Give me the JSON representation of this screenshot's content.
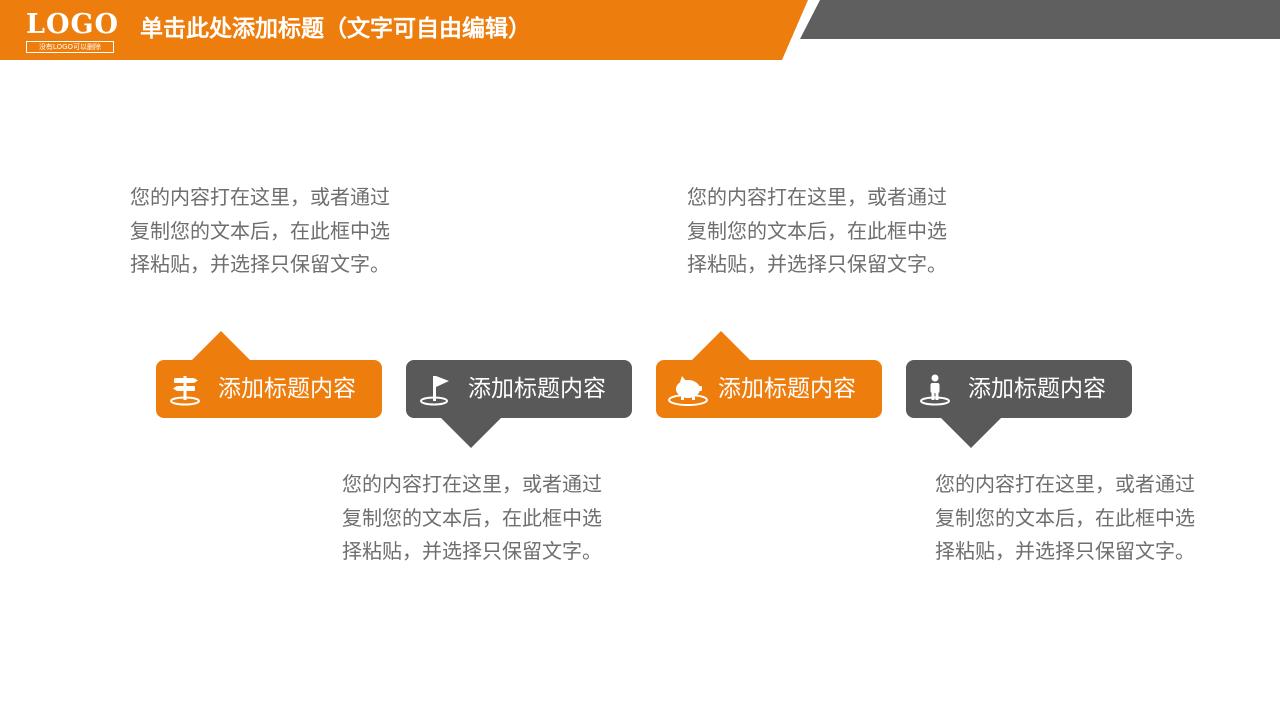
{
  "colors": {
    "orange": "#ED7D0D",
    "gray": "#595959",
    "header_gray": "#5F5F5F",
    "text": "#6E6E6E"
  },
  "header": {
    "logo": "LOGO",
    "logo_sub": "没有LOGO可以删除",
    "title": "单击此处添加标题（文字可自由编辑）"
  },
  "items": [
    {
      "label": "添加标题内容",
      "icon": "signpost-icon",
      "color": "orange",
      "text_position": "above",
      "body": "您的内容打在这里，或者通过复制您的文本后，在此框中选择粘贴，并选择只保留文字。"
    },
    {
      "label": "添加标题内容",
      "icon": "flag-icon",
      "color": "gray",
      "text_position": "below",
      "body": "您的内容打在这里，或者通过复制您的文本后，在此框中选择粘贴，并选择只保留文字。"
    },
    {
      "label": "添加标题内容",
      "icon": "piggy-bank-icon",
      "color": "orange",
      "text_position": "above",
      "body": "您的内容打在这里，或者通过复制您的文本后，在此框中选择粘贴，并选择只保留文字。"
    },
    {
      "label": "添加标题内容",
      "icon": "person-pin-icon",
      "color": "gray",
      "text_position": "below",
      "body": "您的内容打在这里，或者通过复制您的文本后，在此框中选择粘贴，并选择只保留文字。"
    }
  ]
}
